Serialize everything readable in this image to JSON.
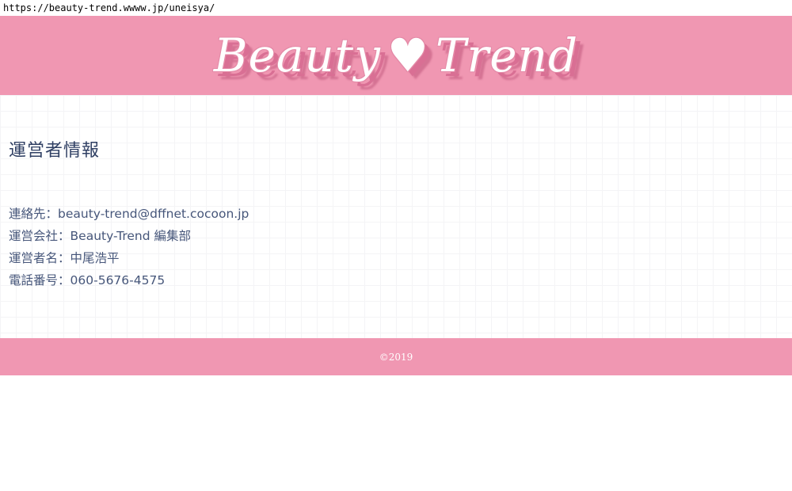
{
  "browser": {
    "url": "https://beauty-trend.wwww.jp/uneisya/"
  },
  "header": {
    "logo_left": "Beauty",
    "logo_heart": "♥",
    "logo_right": "Trend",
    "background": "#f097b2"
  },
  "main": {
    "title": "運営者情報",
    "info": [
      {
        "label": "連絡先",
        "separator": "：",
        "value": "beauty-trend@dffnet.cocoon.jp"
      },
      {
        "label": "運営会社",
        "separator": "：",
        "value": "Beauty-Trend 編集部"
      },
      {
        "label": "運営者名",
        "separator": "：",
        "value": "中尾浩平"
      },
      {
        "label": "電話番号",
        "separator": "：",
        "value": "060-5676-4575"
      }
    ]
  },
  "footer": {
    "copyright": "©2019"
  }
}
